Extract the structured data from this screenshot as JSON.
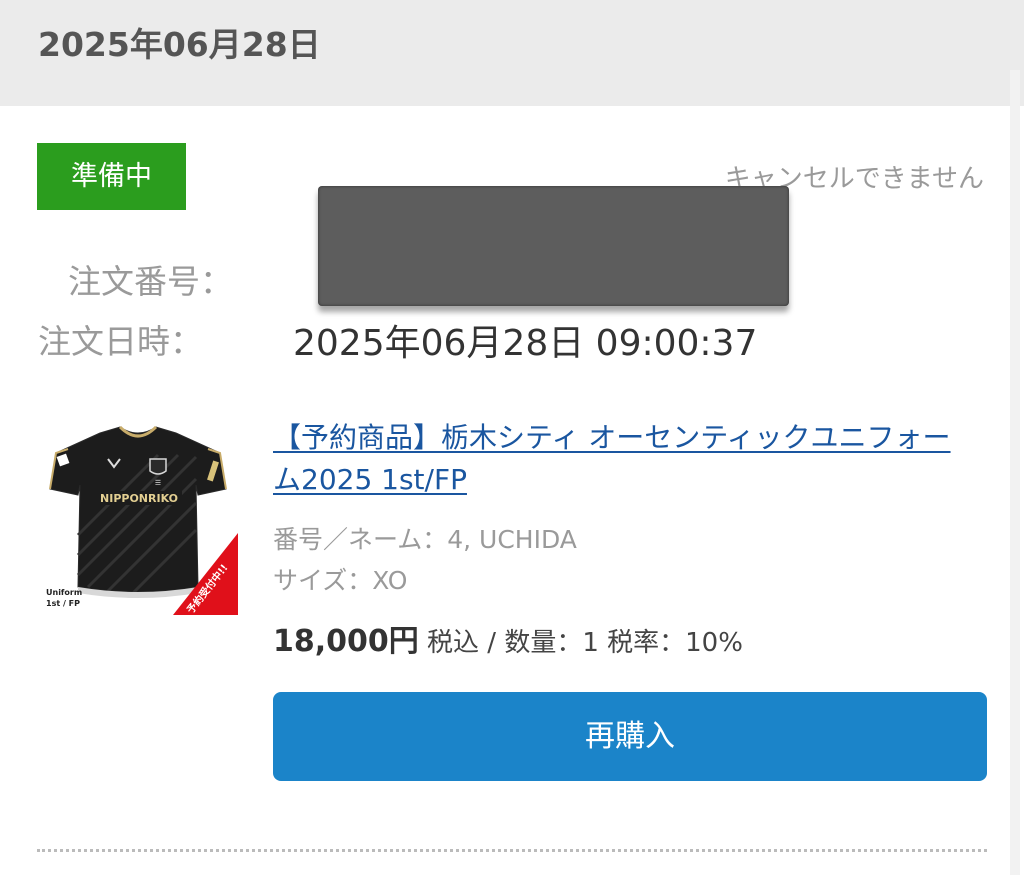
{
  "header": {
    "date": "2025年06月28日"
  },
  "order": {
    "status_badge": "準備中",
    "status_color": "#2b9d1e",
    "cancel_note": "キャンセルできません",
    "order_number_label": "注文番号：",
    "order_date_label": "注文日時：",
    "order_date_value": "2025年06月28日 09:00:37"
  },
  "item": {
    "image_icon": "jersey-image",
    "title": "【予約商品】栃木シティ オーセンティックユニフォーム2025 1st/FP",
    "number_name": "番号／ネーム：4, UCHIDA",
    "size": "サイズ：XO",
    "price": "18,000円",
    "price_suffix": " 税込 / 数量：1 税率：10%",
    "image_texts": {
      "sponsor": "NIPPONRIKO",
      "uniform_label_1": "Uniform",
      "uniform_label_2": "1st / FP",
      "ribbon": "予約受付中!!"
    }
  },
  "actions": {
    "rebuy_label": "再購入",
    "rebuy_color": "#1b84c9"
  }
}
